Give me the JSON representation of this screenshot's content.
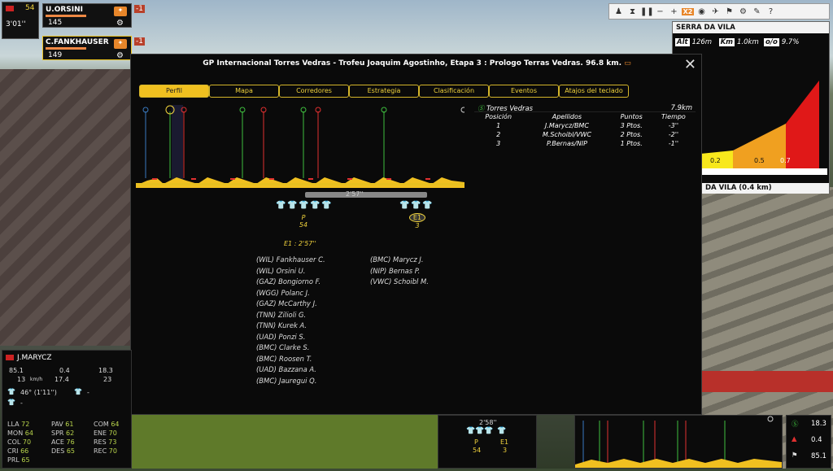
{
  "top_left": {
    "pos_label": "P",
    "pos_value": "54",
    "time": "3'01''",
    "rider1": {
      "name": "U.ORSINI",
      "energy": "145",
      "badge": "-1"
    },
    "rider2": {
      "name": "C.FANKHAUSER",
      "energy": "149",
      "badge": "-1"
    }
  },
  "modal": {
    "title": "GP Internacional Torres Vedras - Trofeu Joaquim Agostinho, Etapa 3 : Prologo Terras Vedras. 96.8 km.",
    "tabs": [
      "Perfil",
      "Mapa",
      "Corredores",
      "Estrategia",
      "Clasificación",
      "Eventos",
      "Atajos del teclado"
    ],
    "gap_label": "2'57''",
    "group1": {
      "label": "P",
      "count": "54"
    },
    "group2": {
      "label": "E1",
      "count": "3"
    },
    "group_gap": "E1 : 2'57''",
    "peloton_list": [
      "(WIL) Fankhauser C.",
      "(WIL) Orsini U.",
      "(GAZ) Bongiorno F.",
      "(WGG) Polanc J.",
      "(GAZ) McCarthy J.",
      "(TNN) Zilioli G.",
      "(TNN) Kurek A.",
      "(UAD) Ponzi S.",
      "(BMC) Clarke S.",
      "(BMC) Roosen T.",
      "(UAD) Bazzana A.",
      "(BMC) Jauregui Q."
    ],
    "escape_list": [
      "(BMC) Marycz J.",
      "(NIP) Bernas P.",
      "(VWC) Schoibl M."
    ],
    "sprint": {
      "name": "Torres Vedras",
      "distance": "7.9km",
      "headers": [
        "Posición",
        "Apellidos",
        "Puntos",
        "Tiempo"
      ],
      "rows": [
        [
          "1",
          "J.Marycz/BMC",
          "3 Ptos.",
          "-3''"
        ],
        [
          "2",
          "M.Schoibl/VWC",
          "2 Ptos.",
          "-2''"
        ],
        [
          "3",
          "P.Bernas/NIP",
          "1 Ptos.",
          "-1''"
        ]
      ]
    }
  },
  "climb": {
    "name": "SERRA DA VILA",
    "alt_label": "Alt",
    "alt": "126m",
    "km_label": "Km",
    "km": "1.0km",
    "grade_label": "o/o",
    "grade": "9.7%",
    "ticks": [
      "0.2",
      "0.5",
      "0.7"
    ],
    "footer": "DA VILA (0.4 km)"
  },
  "toolbar": {
    "speed": "X2"
  },
  "rider_info": {
    "name": "J.MARYCZ",
    "v1": "85.1",
    "v2": "0.4",
    "v3": "18.3",
    "speed": "13",
    "speed_unit": "km/h",
    "v4": "17.4",
    "v5": "23",
    "pos": "46° (1'11'')",
    "dash1": "-",
    "dash2": "-",
    "stats": [
      [
        "LLA",
        "72"
      ],
      [
        "MON",
        "64"
      ],
      [
        "COL",
        "70"
      ],
      [
        "CRI",
        "66"
      ],
      [
        "PRL",
        "65"
      ],
      [
        "PAV",
        "61"
      ],
      [
        "SPR",
        "62"
      ],
      [
        "ACE",
        "76"
      ],
      [
        "DES",
        "65"
      ],
      [
        "COM",
        "64"
      ],
      [
        "ENE",
        "70"
      ],
      [
        "RES",
        "73"
      ],
      [
        "REC",
        "70"
      ]
    ]
  },
  "mini": {
    "gap": "2'58''",
    "g1": "P",
    "g1n": "54",
    "g2": "E1",
    "g2n": "3"
  },
  "right_stats": {
    "s1": "18.3",
    "s2": "0.4",
    "s3": "85.1"
  }
}
